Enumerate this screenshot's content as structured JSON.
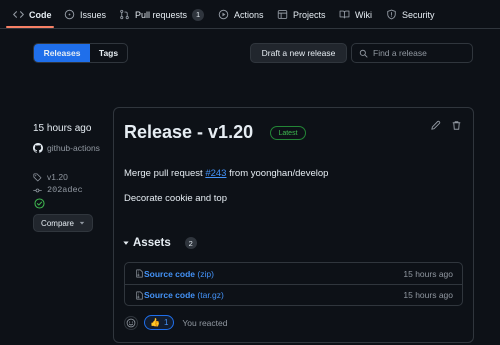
{
  "nav": {
    "items": [
      {
        "label": "Code",
        "icon": "code-icon"
      },
      {
        "label": "Issues",
        "icon": "issue-opened-icon"
      },
      {
        "label": "Pull requests",
        "icon": "git-pull-request-icon",
        "count": "1"
      },
      {
        "label": "Actions",
        "icon": "play-icon"
      },
      {
        "label": "Projects",
        "icon": "table-icon"
      },
      {
        "label": "Wiki",
        "icon": "book-icon"
      },
      {
        "label": "Security",
        "icon": "shield-icon"
      }
    ],
    "active": "Code",
    "underline_color": "#f78166"
  },
  "toolbar": {
    "releases_tab": "Releases",
    "tags_tab": "Tags",
    "draft_button": "Draft a new release",
    "search_placeholder": "Find a release"
  },
  "release": {
    "published": "15 hours ago",
    "author": "github-actions",
    "tag": "v1.20",
    "commit": "202adec",
    "compare_label": "Compare",
    "title": "Release - v1.20",
    "latest_badge": "Latest",
    "body": {
      "line1_prefix": "Merge pull request ",
      "line1_link": "#243",
      "line1_suffix": " from yoonghan/develop",
      "line2": "Decorate cookie and top"
    },
    "assets": {
      "heading": "Assets",
      "count": "2",
      "items": [
        {
          "name": "Source code",
          "kind": "(zip)",
          "time": "15 hours ago"
        },
        {
          "name": "Source code",
          "kind": "(tar.gz)",
          "time": "15 hours ago"
        }
      ]
    },
    "reactions": {
      "emoji": "👍",
      "count": "1",
      "text": "You reacted"
    }
  },
  "colors": {
    "background": "#0d1117",
    "border": "#30363d",
    "accent_blue": "#1f6feb",
    "link_blue": "#4493f8",
    "success_green": "#3fb950",
    "muted_text": "#9198a1"
  }
}
